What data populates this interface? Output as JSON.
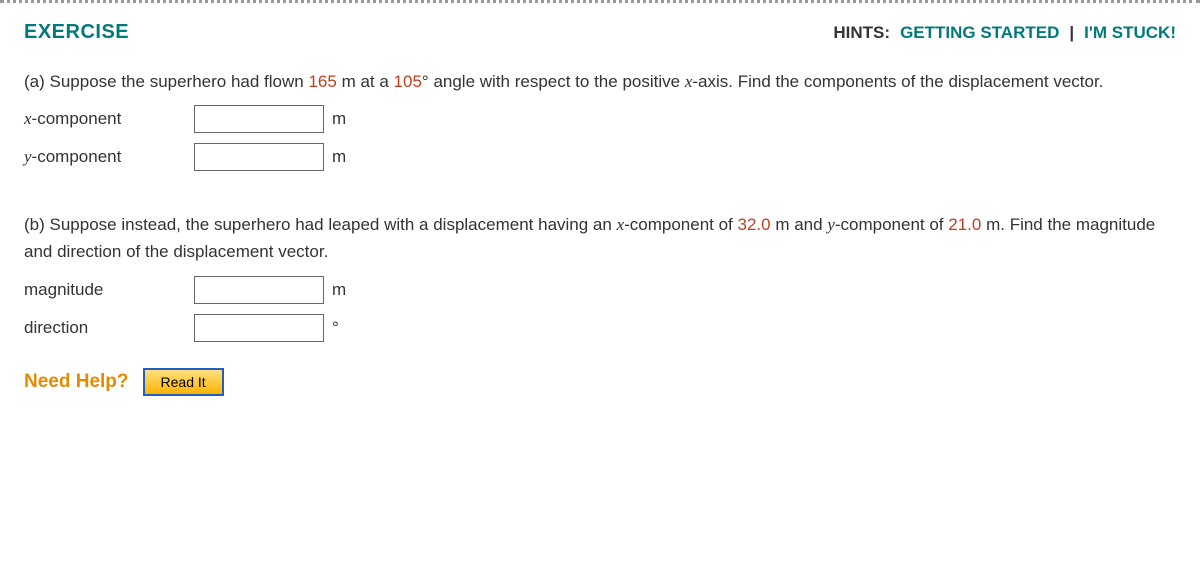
{
  "header": {
    "title": "EXERCISE",
    "hints_label": "HINTS:",
    "getting_started": "GETTING STARTED",
    "separator": "|",
    "im_stuck": "I'M STUCK!"
  },
  "partA": {
    "prefix": "(a) Suppose the superhero had flown ",
    "val1": "165",
    "mid1": " m at a ",
    "val2": "105",
    "degree": "°",
    "suffix": " angle with respect to the positive ",
    "axis_var": "x",
    "tail": "-axis. Find the components of the displacement vector.",
    "rows": [
      {
        "label_var": "x",
        "label_suffix": "-component",
        "unit": "m"
      },
      {
        "label_var": "y",
        "label_suffix": "-component",
        "unit": "m"
      }
    ]
  },
  "partB": {
    "prefix": "(b) Suppose instead, the superhero had leaped with a displacement having an ",
    "xvar": "x",
    "mid1": "-component of ",
    "val1": "32.0",
    "mid2": " m and ",
    "yvar": "y",
    "mid3": "-component of ",
    "val2": "21.0",
    "tail": " m. Find the magnitude and direction of the displacement vector.",
    "rows": [
      {
        "label": "magnitude",
        "unit": "m"
      },
      {
        "label": "direction",
        "unit": "°"
      }
    ]
  },
  "help": {
    "label": "Need Help?",
    "read_it": "Read It"
  }
}
